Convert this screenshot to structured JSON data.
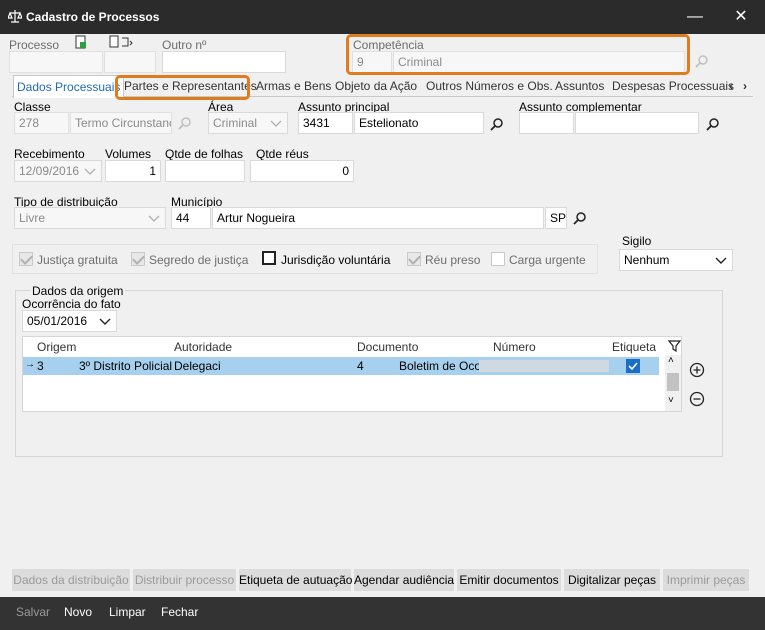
{
  "window": {
    "title": "Cadastro de Processos",
    "minimize": "—",
    "close": "✕"
  },
  "header": {
    "processo_label": "Processo",
    "outro_label": "Outro nº",
    "competencia_label": "Competência",
    "competencia_code": "9",
    "competencia_value": "Criminal"
  },
  "tabs": [
    "Dados Processuais",
    "Partes e Representantes",
    "Armas e Bens",
    "Objeto da Ação",
    "Outros Números e Obs.",
    "Assuntos",
    "Despesas Processuais"
  ],
  "form": {
    "classe_label": "Classe",
    "classe_code": "278",
    "classe_value": "Termo Circunstanci",
    "area_label": "Área",
    "area_value": "Criminal",
    "assunto_principal_label": "Assunto principal",
    "assunto_principal_code": "3431",
    "assunto_principal_value": "Estelionato",
    "assunto_compl_label": "Assunto complementar",
    "recebimento_label": "Recebimento",
    "recebimento_value": "12/09/2016",
    "volumes_label": "Volumes",
    "volumes_value": "1",
    "qtde_folhas_label": "Qtde de folhas",
    "qtde_reus_label": "Qtde réus",
    "qtde_reus_value": "0",
    "tipo_dist_label": "Tipo de distribuição",
    "tipo_dist_value": "Livre",
    "municipio_label": "Município",
    "municipio_code": "44",
    "municipio_value": "Artur Nogueira",
    "municipio_uf": "SP",
    "justica_gratuita": "Justiça gratuita",
    "segredo_justica": "Segredo de justiça",
    "jurisdicao_voluntaria": "Jurisdição voluntária",
    "reu_preso": "Réu preso",
    "carga_urgente": "Carga urgente",
    "sigilo_label": "Sigilo",
    "sigilo_value": "Nenhum"
  },
  "origem": {
    "group_title": "Dados da origem",
    "ocorrencia_label": "Ocorrência do fato",
    "ocorrencia_value": "05/01/2016",
    "columns": [
      "Origem",
      "Autoridade",
      "Documento",
      "Número",
      "Etiqueta"
    ],
    "row": {
      "origem_code": "3",
      "origem_name": "3º Distrito Policial",
      "autoridade": "Delegaci",
      "documento_code": "4",
      "documento_name": "Boletim de Oco"
    }
  },
  "buttons": {
    "dados_distribuicao": "Dados da distribuição",
    "distribuir": "Distribuir processo",
    "etiqueta": "Etiqueta de autuação",
    "agendar": "Agendar audiência",
    "emitir": "Emitir documentos",
    "digitalizar": "Digitalizar peças",
    "imprimir": "Imprimir peças"
  },
  "bottom": {
    "salvar": "Salvar",
    "novo": "Novo",
    "limpar": "Limpar",
    "fechar": "Fechar"
  },
  "colors": {
    "highlight": "#e07b1e",
    "selected_row": "#a6d0ee",
    "active_tab": "#1f6bb5"
  }
}
